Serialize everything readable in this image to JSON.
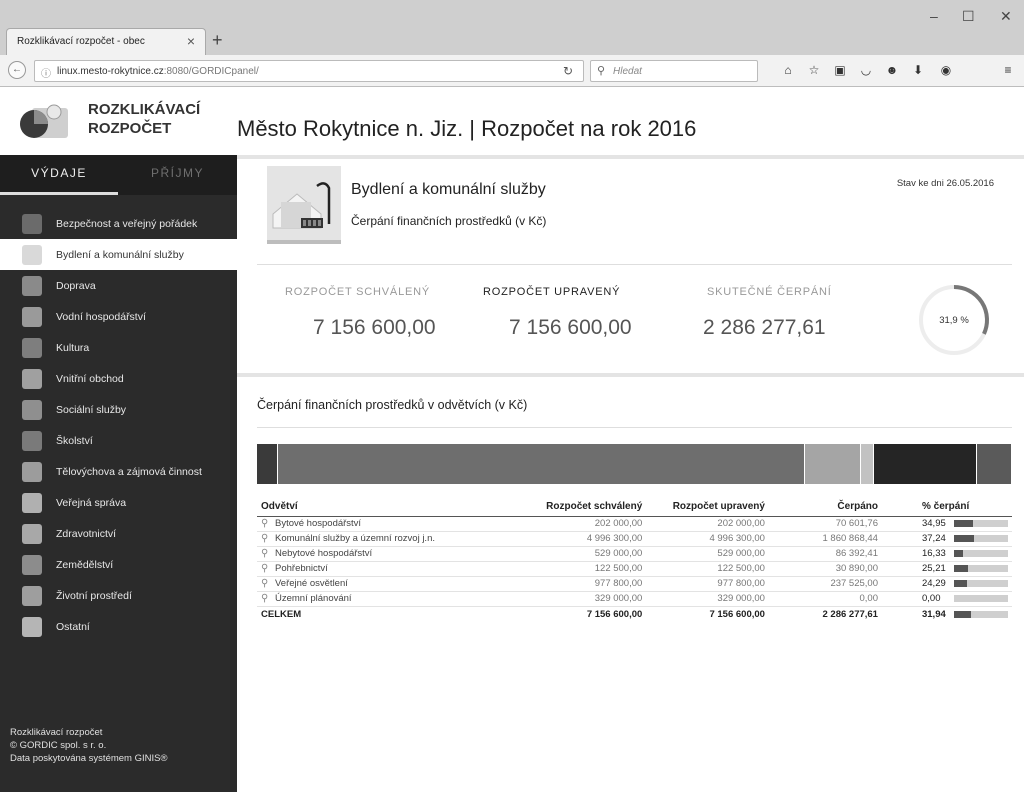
{
  "browser": {
    "tab_title": "Rozklikávací rozpočet - obec",
    "url_host": "linux.mesto-rokytnice.cz",
    "url_rest": ":8080/GORDICpanel/",
    "search_placeholder": "Hledat"
  },
  "brand": {
    "line1": "ROZKLIKÁVACÍ",
    "line2": "ROZPOČET"
  },
  "sidebar": {
    "tabs": [
      {
        "label": "VÝDAJE",
        "active": true
      },
      {
        "label": "PŘÍJMY",
        "active": false
      }
    ],
    "items": [
      {
        "label": "Bezpečnost a veřejný pořádek",
        "icon": "police-icon",
        "color": "#6b6b6b"
      },
      {
        "label": "Bydlení a komunální služby",
        "icon": "house-icon",
        "color": "#d9d9d9",
        "active": true
      },
      {
        "label": "Doprava",
        "icon": "road-icon",
        "color": "#8a8a8a"
      },
      {
        "label": "Vodní hospodářství",
        "icon": "water-drop-icon",
        "color": "#9a9a9a"
      },
      {
        "label": "Kultura",
        "icon": "theater-icon",
        "color": "#7e7e7e"
      },
      {
        "label": "Vnitřní obchod",
        "icon": "building-icon",
        "color": "#a0a0a0"
      },
      {
        "label": "Sociální služby",
        "icon": "people-icon",
        "color": "#8f8f8f"
      },
      {
        "label": "Školství",
        "icon": "graduation-cap-icon",
        "color": "#7a7a7a"
      },
      {
        "label": "Tělovýchova a zájmová činnost",
        "icon": "sport-icon",
        "color": "#9c9c9c"
      },
      {
        "label": "Veřejná správa",
        "icon": "office-icon",
        "color": "#b0b0b0"
      },
      {
        "label": "Zdravotnictví",
        "icon": "health-icon",
        "color": "#a8a8a8"
      },
      {
        "label": "Zemědělství",
        "icon": "tractor-icon",
        "color": "#8c8c8c"
      },
      {
        "label": "Životní prostředí",
        "icon": "environment-icon",
        "color": "#9e9e9e"
      },
      {
        "label": "Ostatní",
        "icon": "other-icon",
        "color": "#b5b5b5"
      }
    ],
    "footer": [
      "Rozklikávací rozpočet",
      "© GORDIC spol. s r. o.",
      "Data poskytována systémem GINIS®"
    ]
  },
  "main": {
    "title": "Město Rokytnice n. Jiz. | Rozpočet na rok 2016",
    "category_title": "Bydlení a komunální služby",
    "category_subtitle": "Čerpání finančních prostředků (v Kč)",
    "stav": "Stav ke dni 26.05.2016",
    "kpis": [
      {
        "label": "ROZPOČET SCHVÁLENÝ",
        "value": "7 156 600,00",
        "strong": false
      },
      {
        "label": "ROZPOČET UPRAVENÝ",
        "value": "7 156 600,00",
        "strong": true
      },
      {
        "label": "SKUTEČNÉ ČERPÁNÍ",
        "value": "2 286 277,61",
        "strong": false
      }
    ],
    "percent_label": "31,9 %",
    "percent_value": 31.9,
    "section_title": "Čerpání finančních prostředků v odvětvích (v Kč)",
    "strip_segments": [
      {
        "share": 0.0282,
        "color": "#3a3a3a"
      },
      {
        "share": 0.6981,
        "color": "#6e6e6e"
      },
      {
        "share": 0.0739,
        "color": "#a5a5a5"
      },
      {
        "share": 0.0171,
        "color": "#c2c2c2"
      },
      {
        "share": 0.1366,
        "color": "#252525"
      },
      {
        "share": 0.0461,
        "color": "#5a5a5a"
      }
    ],
    "table": {
      "headers": [
        "Odvětví",
        "Rozpočet schválený",
        "Rozpočet upravený",
        "Čerpáno",
        "% čerpání"
      ],
      "rows": [
        {
          "name": "Bytové hospodářství",
          "approved": "202 000,00",
          "adjusted": "202 000,00",
          "spent": "70 601,76",
          "pct": "34,95",
          "pct_value": 34.95
        },
        {
          "name": "Komunální služby a územní rozvoj j.n.",
          "approved": "4 996 300,00",
          "adjusted": "4 996 300,00",
          "spent": "1 860 868,44",
          "pct": "37,24",
          "pct_value": 37.24
        },
        {
          "name": "Nebytové hospodářství",
          "approved": "529 000,00",
          "adjusted": "529 000,00",
          "spent": "86 392,41",
          "pct": "16,33",
          "pct_value": 16.33
        },
        {
          "name": "Pohřebnictví",
          "approved": "122 500,00",
          "adjusted": "122 500,00",
          "spent": "30 890,00",
          "pct": "25,21",
          "pct_value": 25.21
        },
        {
          "name": "Veřejné osvětlení",
          "approved": "977 800,00",
          "adjusted": "977 800,00",
          "spent": "237 525,00",
          "pct": "24,29",
          "pct_value": 24.29
        },
        {
          "name": "Územní plánování",
          "approved": "329 000,00",
          "adjusted": "329 000,00",
          "spent": "0,00",
          "pct": "0,00",
          "pct_value": 0
        }
      ],
      "total": {
        "name": "CELKEM",
        "approved": "7 156 600,00",
        "adjusted": "7 156 600,00",
        "spent": "2 286 277,61",
        "pct": "31,94",
        "pct_value": 31.94
      }
    }
  }
}
